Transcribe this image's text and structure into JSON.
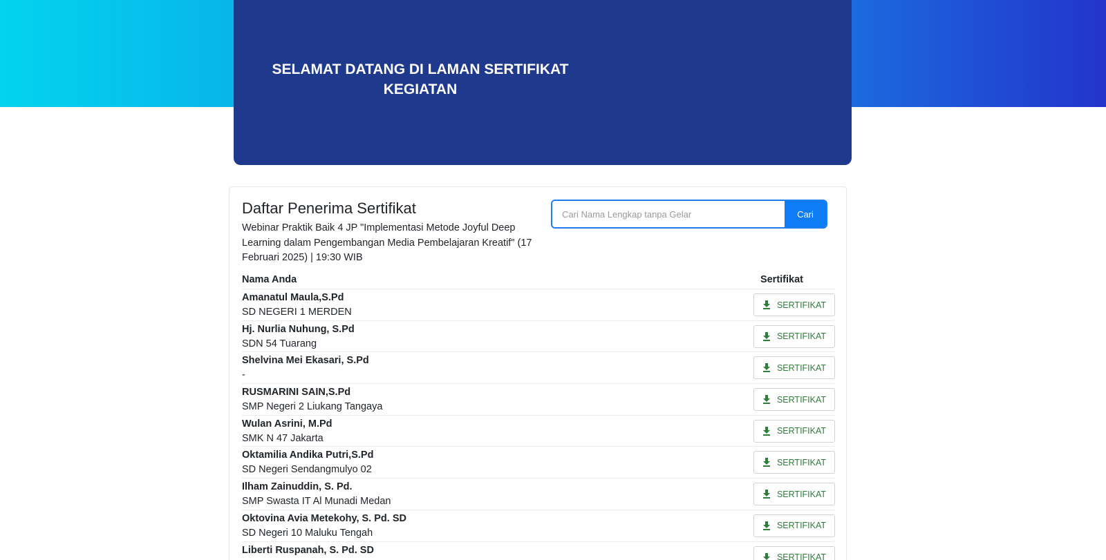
{
  "hero": {
    "title": "SELAMAT DATANG DI LAMAN SERTIFIKAT KEGIATAN"
  },
  "card": {
    "title": "Daftar Penerima Sertifikat",
    "subtitle": "Webinar Praktik Baik 4 JP \"Implementasi Metode Joyful Deep Learning dalam Pengembangan Media Pembelajaran Kreatif\" (17 Februari 2025) | 19:30 WIB"
  },
  "search": {
    "placeholder": "Cari Nama Lengkap tanpa Gelar",
    "value": "",
    "button_label": "Cari"
  },
  "table": {
    "headers": {
      "name": "Nama Anda",
      "certificate": "Sertifikat"
    },
    "button_label": "SERTIFIKAT",
    "button_icon": "download-icon",
    "rows": [
      {
        "name": "Amanatul Maula,S.Pd",
        "school": "SD NEGERI 1 MERDEN"
      },
      {
        "name": "Hj. Nurlia Nuhung, S.Pd",
        "school": "SDN 54 Tuarang"
      },
      {
        "name": "Shelvina Mei Ekasari, S.Pd",
        "school": "-"
      },
      {
        "name": "RUSMARINI SAIN,S.Pd",
        "school": "SMP Negeri 2 Liukang Tangaya"
      },
      {
        "name": "Wulan Asrini, M.Pd",
        "school": "SMK N 47 Jakarta"
      },
      {
        "name": "Oktamilia Andika Putri,S.Pd",
        "school": "SD Negeri Sendangmulyo 02"
      },
      {
        "name": "Ilham Zainuddin, S. Pd.",
        "school": "SMP Swasta IT Al Munadi Medan"
      },
      {
        "name": "Oktovina Avia Metekohy, S. Pd. SD",
        "school": "SD Negeri 10 Maluku Tengah"
      },
      {
        "name": "Liberti Ruspanah, S. Pd. SD",
        "school": ""
      }
    ]
  },
  "colors": {
    "hero_bg": "#1f3a8c",
    "accent_button": "#0d7cf5",
    "cert_text": "#2f7d3a"
  }
}
